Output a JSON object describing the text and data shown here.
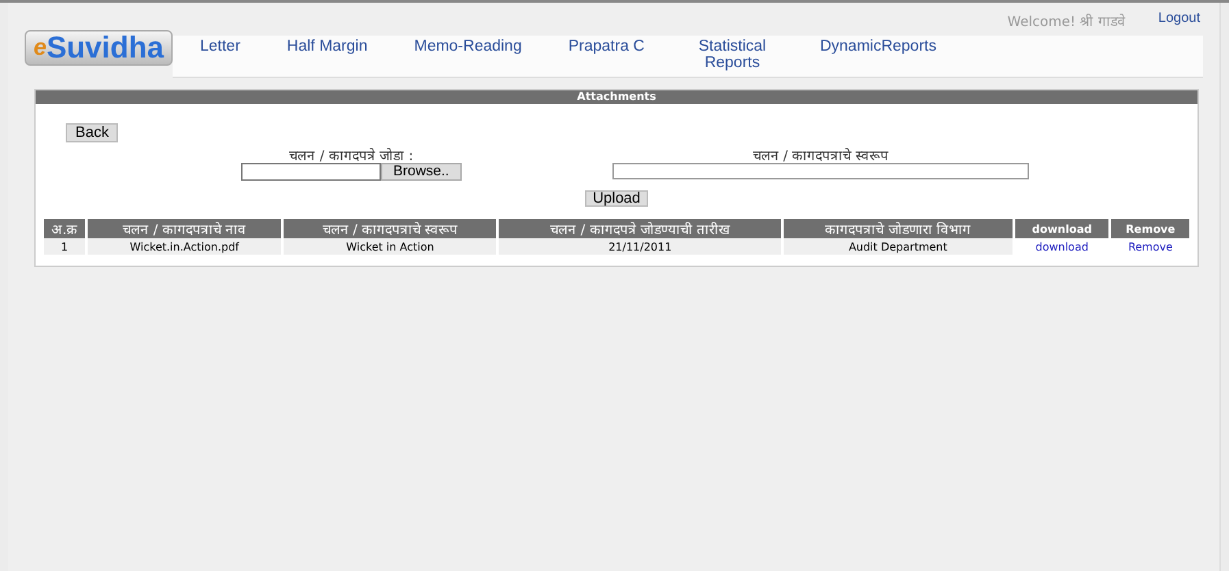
{
  "header": {
    "logo": {
      "prefix": "e",
      "name": "Suvidha"
    },
    "welcome": "Welcome! श्री गाडवे",
    "logout": "Logout"
  },
  "nav": [
    "Letter",
    "Half Margin",
    "Memo-Reading",
    "Prapatra C",
    "Statistical Reports",
    "DynamicReports"
  ],
  "panel": {
    "title": "Attachments",
    "back": "Back",
    "file_label": "चलन / कागदपत्रे जोडा :",
    "browse": "Browse..",
    "desc_label": "चलन / कागदपत्राचे स्वरूप",
    "upload": "Upload"
  },
  "table": {
    "columns": [
      "अ.क्र",
      "चलन / कागदपत्राचे नाव",
      "चलन / कागदपत्राचे स्वरूप",
      "चलन / कागदपत्रे जोडण्याची तारीख",
      "कागदपत्राचे जोडणारा विभाग",
      "download",
      "Remove"
    ],
    "rows": [
      {
        "cells": [
          "1",
          "Wicket.in.Action.pdf",
          "Wicket in Action",
          "21/11/2011",
          "Audit Department"
        ],
        "download": "download",
        "remove": "Remove"
      }
    ]
  }
}
